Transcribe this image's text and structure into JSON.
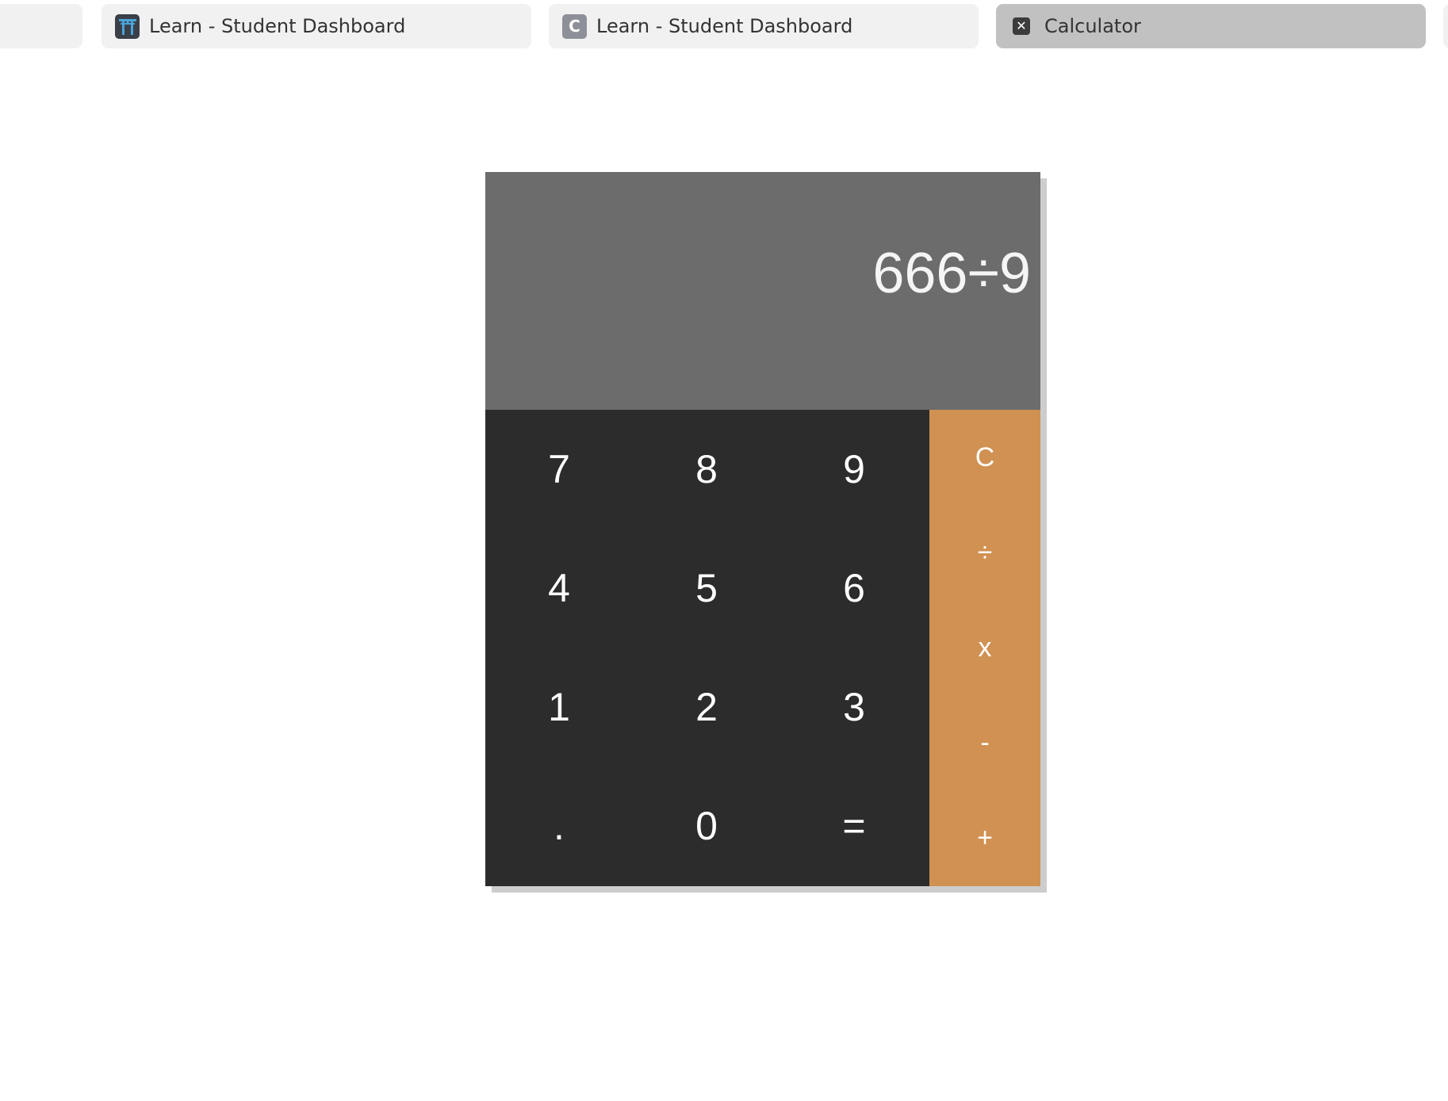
{
  "browser": {
    "tabs": [
      {
        "title": "",
        "icon": "blank-tab",
        "active": false
      },
      {
        "title": "Learn - Student Dashboard",
        "icon": "torii-gate-icon",
        "active": false
      },
      {
        "title": "Learn - Student Dashboard",
        "icon": "c-letter-icon",
        "icon_text": "C",
        "active": false
      },
      {
        "title": "Calculator",
        "icon": "close-box-icon",
        "icon_text": "✕",
        "active": true
      }
    ]
  },
  "calculator": {
    "display": "666÷9",
    "keys": [
      [
        "7",
        "8",
        "9"
      ],
      [
        "4",
        "5",
        "6"
      ],
      [
        "1",
        "2",
        "3"
      ],
      [
        ".",
        "0",
        "="
      ]
    ],
    "operators": [
      "C",
      "÷",
      "x",
      "-",
      "+"
    ]
  },
  "colors": {
    "display_bg": "#6c6c6c",
    "keypad_bg": "#2c2c2c",
    "operator_bg": "#d09152",
    "active_tab_bg": "#c1c1c1",
    "tab_bg": "#f1f1f1"
  }
}
